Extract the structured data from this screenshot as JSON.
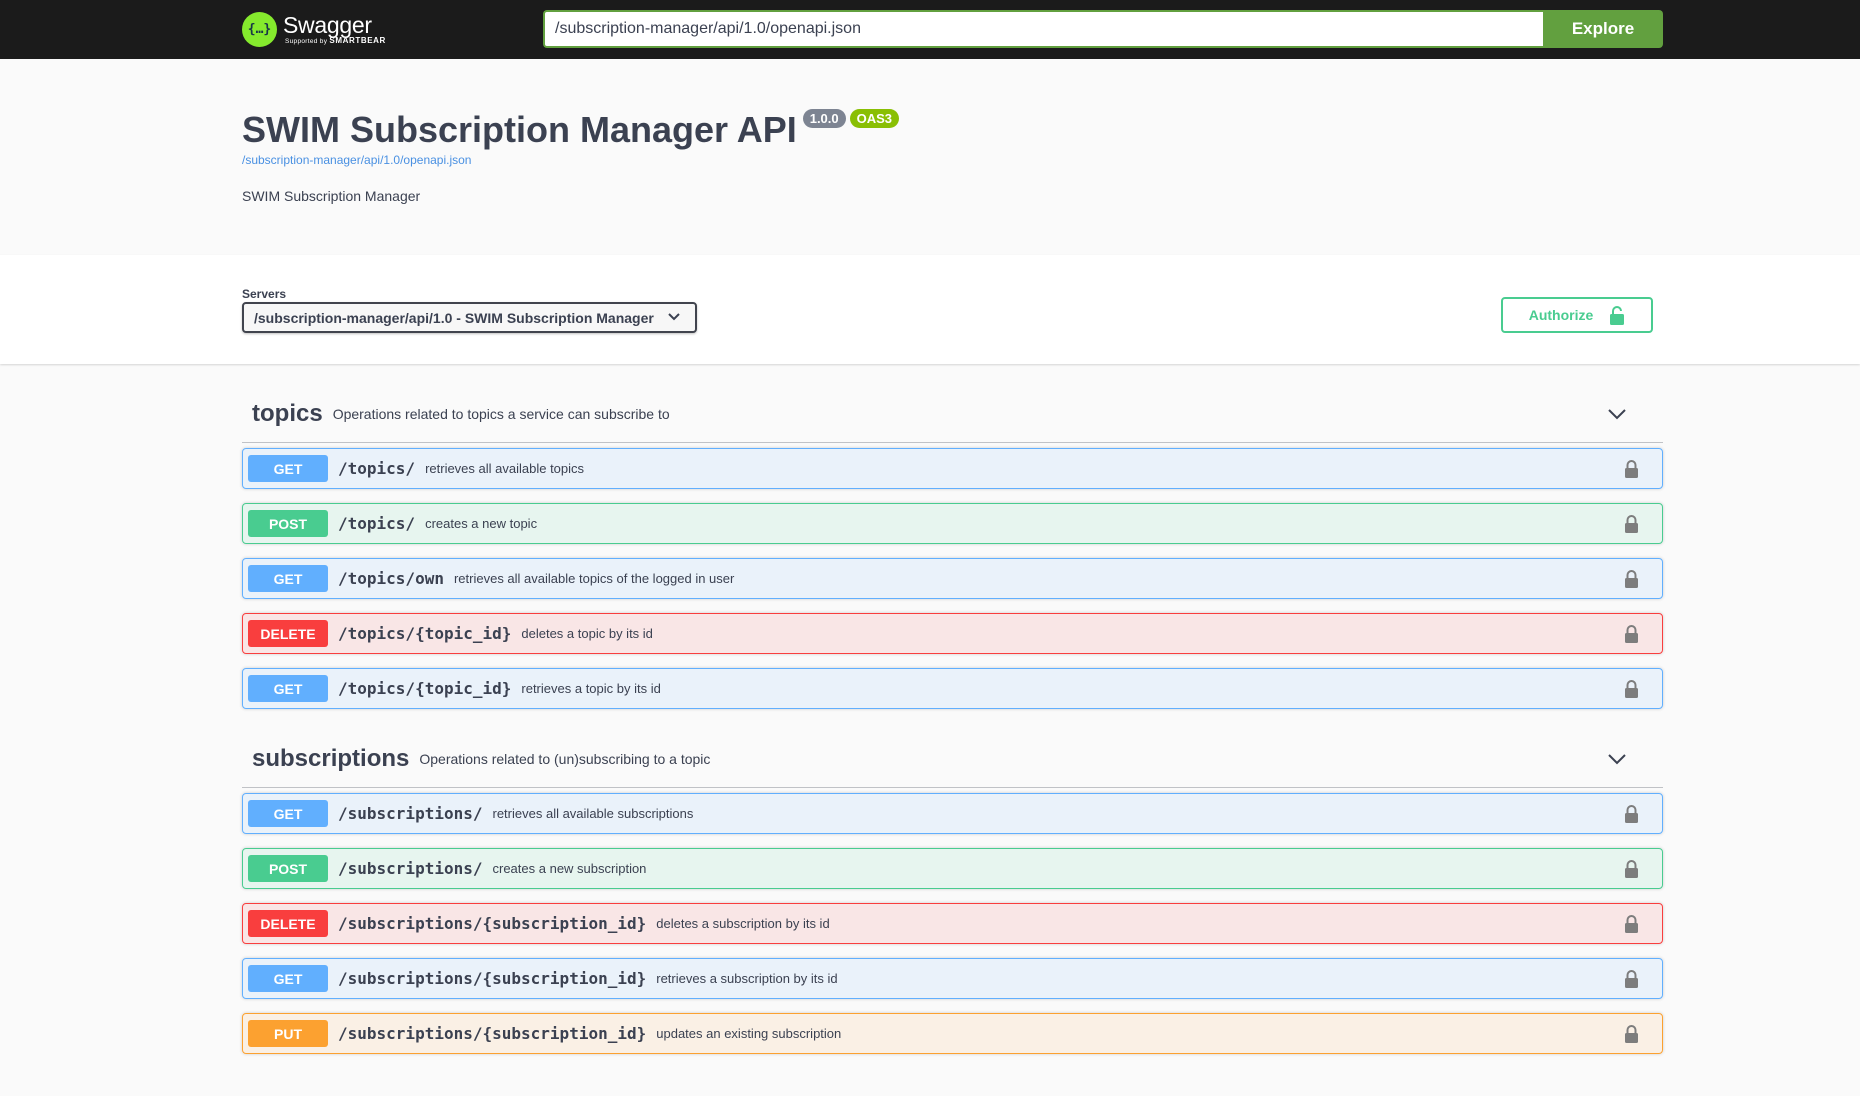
{
  "topbar": {
    "logo_name": "Swagger",
    "logo_sub_prefix": "Supported by",
    "logo_sub_brand": "SMARTBEAR",
    "url_value": "/subscription-manager/api/1.0/openapi.json",
    "explore_label": "Explore"
  },
  "info": {
    "title": "SWIM Subscription Manager API",
    "version_badge": "1.0.0",
    "oas_badge": "OAS3",
    "spec_link": "/subscription-manager/api/1.0/openapi.json",
    "description": "SWIM Subscription Manager"
  },
  "servers": {
    "label": "Servers",
    "selected": "/subscription-manager/api/1.0 - SWIM Subscription Manager"
  },
  "authorize": {
    "label": "Authorize"
  },
  "colors": {
    "get": "#61affe",
    "post": "#49cc90",
    "delete": "#f93e3e",
    "put": "#fca130",
    "explore": "#62a03f"
  },
  "tags": [
    {
      "name": "topics",
      "description": "Operations related to topics a service can subscribe to",
      "operations": [
        {
          "method": "GET",
          "path": "/topics/",
          "summary": "retrieves all available topics"
        },
        {
          "method": "POST",
          "path": "/topics/",
          "summary": "creates a new topic"
        },
        {
          "method": "GET",
          "path": "/topics/own",
          "summary": "retrieves all available topics of the logged in user"
        },
        {
          "method": "DELETE",
          "path": "/topics/{topic_id}",
          "summary": "deletes a topic by its id"
        },
        {
          "method": "GET",
          "path": "/topics/{topic_id}",
          "summary": "retrieves a topic by its id"
        }
      ]
    },
    {
      "name": "subscriptions",
      "description": "Operations related to (un)subscribing to a topic",
      "operations": [
        {
          "method": "GET",
          "path": "/subscriptions/",
          "summary": "retrieves all available subscriptions"
        },
        {
          "method": "POST",
          "path": "/subscriptions/",
          "summary": "creates a new subscription"
        },
        {
          "method": "DELETE",
          "path": "/subscriptions/{subscription_id}",
          "summary": "deletes a subscription by its id"
        },
        {
          "method": "GET",
          "path": "/subscriptions/{subscription_id}",
          "summary": "retrieves a subscription by its id"
        },
        {
          "method": "PUT",
          "path": "/subscriptions/{subscription_id}",
          "summary": "updates an existing subscription"
        }
      ]
    }
  ]
}
